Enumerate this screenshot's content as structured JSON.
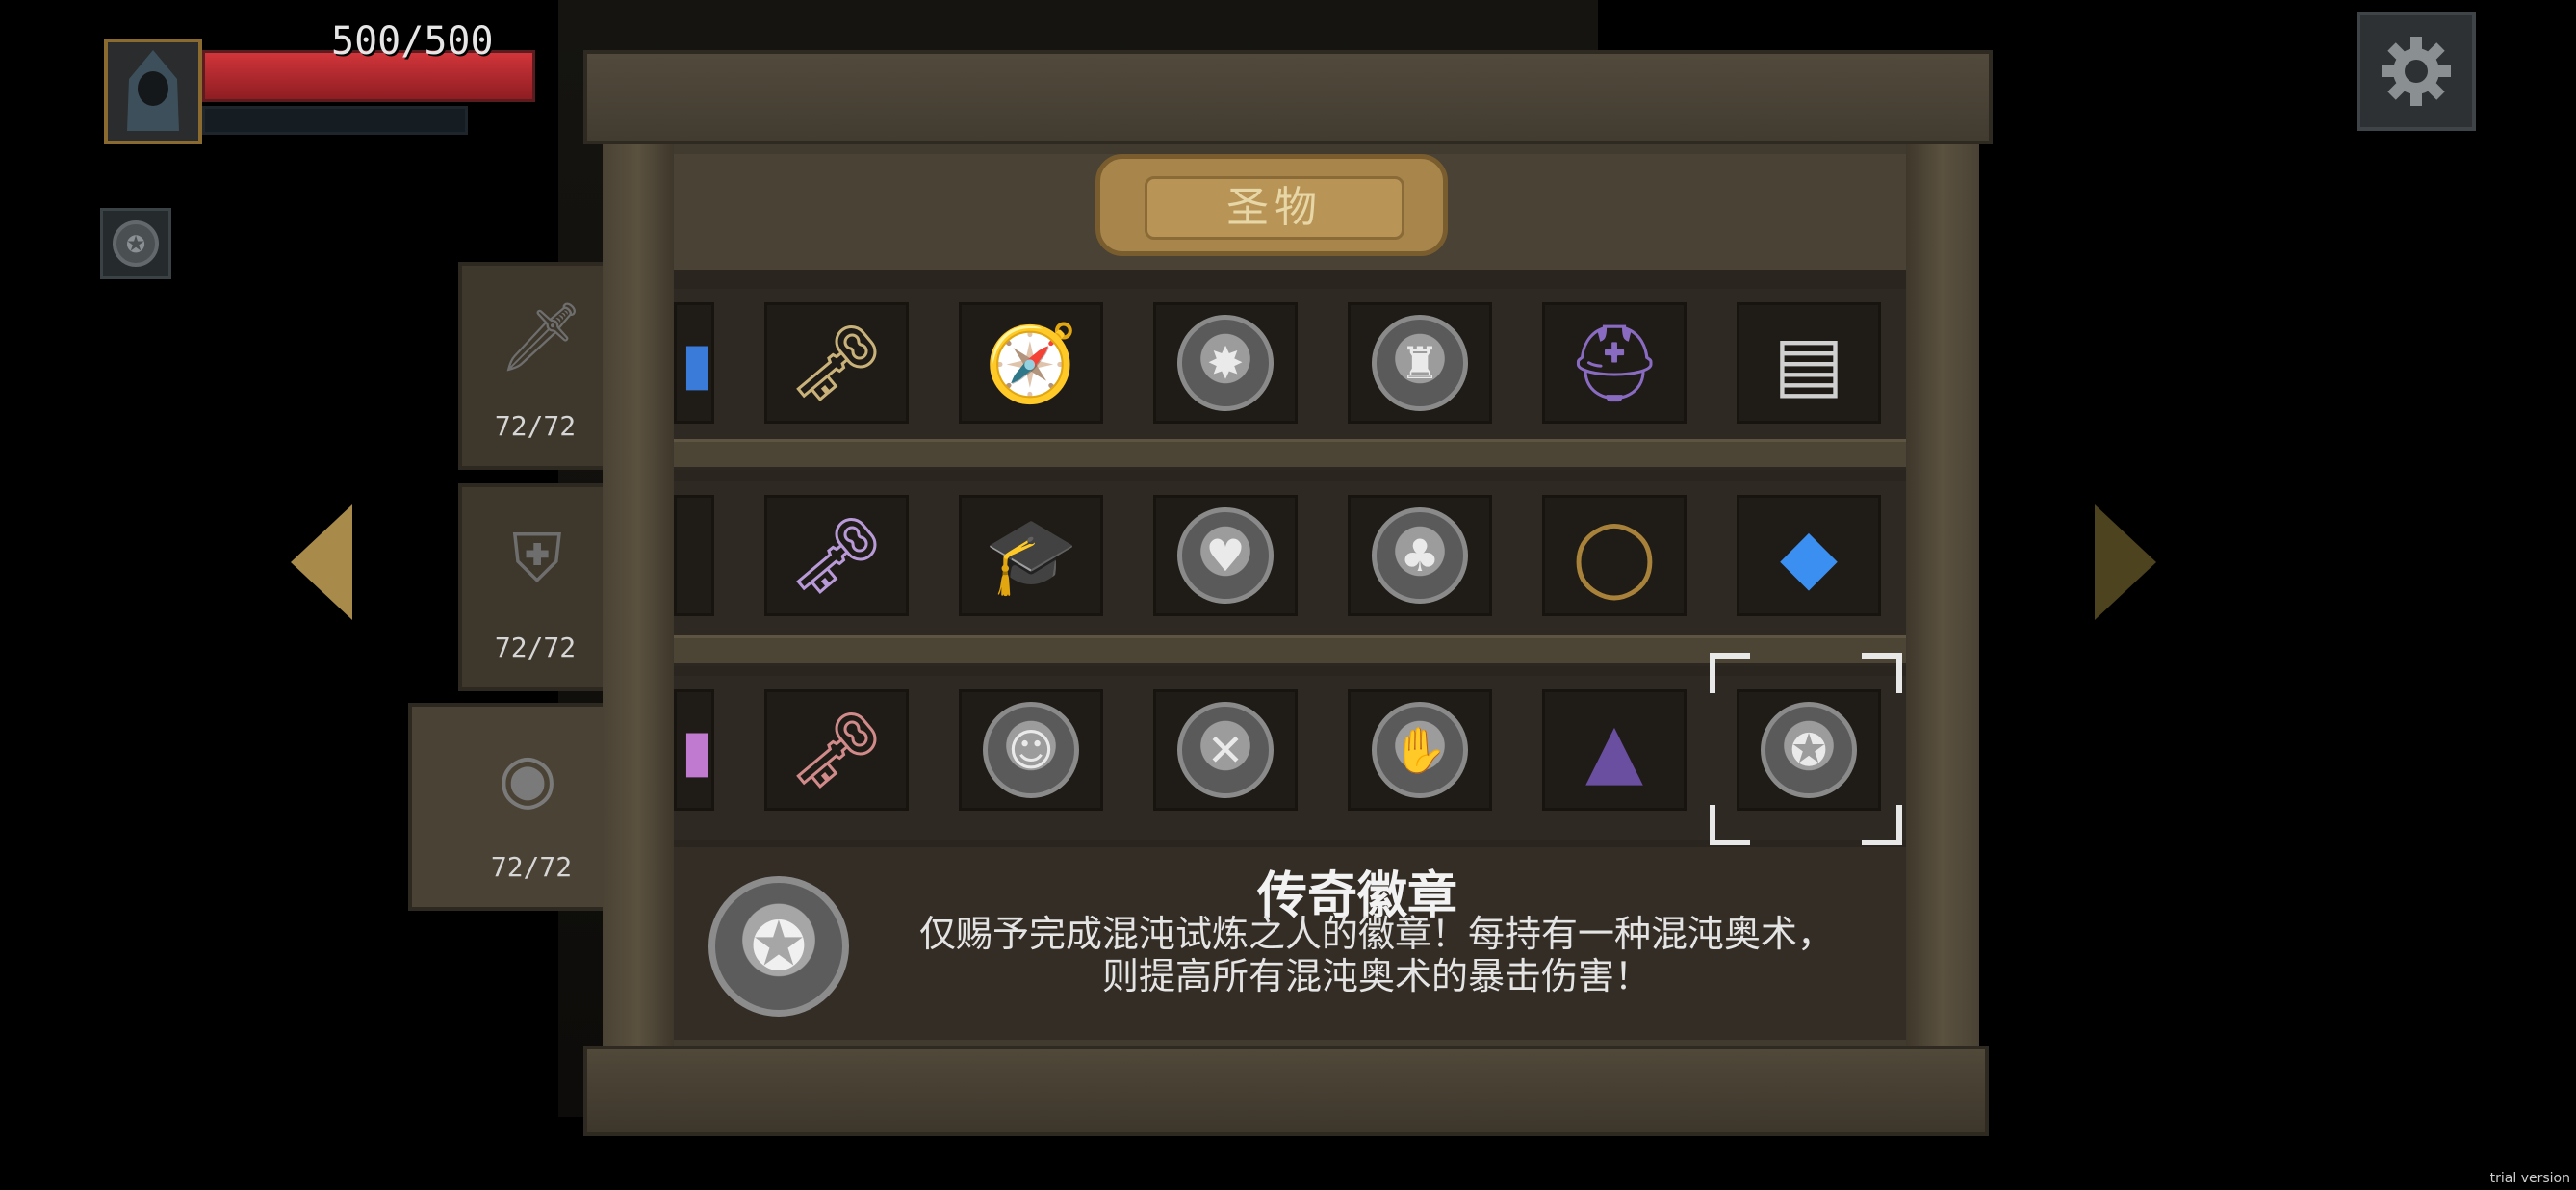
{
  "hud": {
    "hp_text": "500/500",
    "hp_fraction": 1.0,
    "portrait_icon": "hooded-figure-icon",
    "buff_icon": "legend-badge-icon",
    "settings_icon": "gear-icon"
  },
  "side_tabs": [
    {
      "icon": "sword-icon",
      "glyph": "🗡",
      "count": "72/72"
    },
    {
      "icon": "shield-icon",
      "glyph": "⛨",
      "count": "72/72"
    },
    {
      "icon": "relic-icon",
      "glyph": "◉",
      "count": "72/72"
    }
  ],
  "cabinet": {
    "title": "圣物"
  },
  "items": [
    [
      {
        "name": "blue-item-icon",
        "glyph": "▮",
        "color": "#3a7ad8"
      },
      {
        "name": "green-gem-key-icon",
        "glyph": "🗝",
        "color": "#c9b27a"
      },
      {
        "name": "compass-icon",
        "glyph": "🧭",
        "color": "#5ea37a"
      },
      {
        "name": "silver-badge-icon",
        "glyph": "✸",
        "color": "#dcdcdc",
        "coin": true
      },
      {
        "name": "silver-badge-icon",
        "glyph": "♜",
        "color": "#dcdcdc",
        "coin": true
      },
      {
        "name": "horned-helmet-icon",
        "glyph": "⛑",
        "color": "#8a6bc2"
      },
      {
        "name": "paint-palette-icon",
        "glyph": "▤",
        "color": "#d0d0d0"
      }
    ],
    [
      {
        "name": "partial-item-icon",
        "glyph": "",
        "color": "#555"
      },
      {
        "name": "purple-gem-key-icon",
        "glyph": "🗝",
        "color": "#b99ad8"
      },
      {
        "name": "graduation-cap-icon",
        "glyph": "🎓",
        "color": "#333"
      },
      {
        "name": "silver-badge-icon",
        "glyph": "♥",
        "color": "#dcdcdc",
        "coin": true
      },
      {
        "name": "silver-badge-icon",
        "glyph": "♣",
        "color": "#dcdcdc",
        "coin": true
      },
      {
        "name": "bracelet-icon",
        "glyph": "◯",
        "color": "#a8823a"
      },
      {
        "name": "blue-crystal-icon",
        "glyph": "◆",
        "color": "#3b8ff0"
      }
    ],
    [
      {
        "name": "pink-item-icon",
        "glyph": "▮",
        "color": "#c07ad0"
      },
      {
        "name": "red-gem-key-icon",
        "glyph": "🗝",
        "color": "#d08a8a"
      },
      {
        "name": "silver-badge-icon",
        "glyph": "☺",
        "color": "#dcdcdc",
        "coin": true
      },
      {
        "name": "silver-badge-icon",
        "glyph": "✕",
        "color": "#dcdcdc",
        "coin": true
      },
      {
        "name": "silver-badge-icon",
        "glyph": "✋",
        "color": "#dcdcdc",
        "coin": true
      },
      {
        "name": "wizard-hood-icon",
        "glyph": "▲",
        "color": "#6a4fa0"
      },
      {
        "name": "legend-badge-icon",
        "glyph": "✪",
        "color": "#dcdcdc",
        "coin": true
      }
    ]
  ],
  "selected": {
    "title": "传奇徽章",
    "line1": "仅赐予完成混沌试炼之人的徽章！每持有一种混沌奥术，",
    "line2": "则提高所有混沌奥术的暴击伤害！",
    "icon": "legend-badge-icon",
    "glyph": "✪"
  },
  "watermark": "trial version",
  "colors": {
    "hp": "#c62f35",
    "gold_trim": "#a8854a",
    "wood": "#413a2f"
  }
}
